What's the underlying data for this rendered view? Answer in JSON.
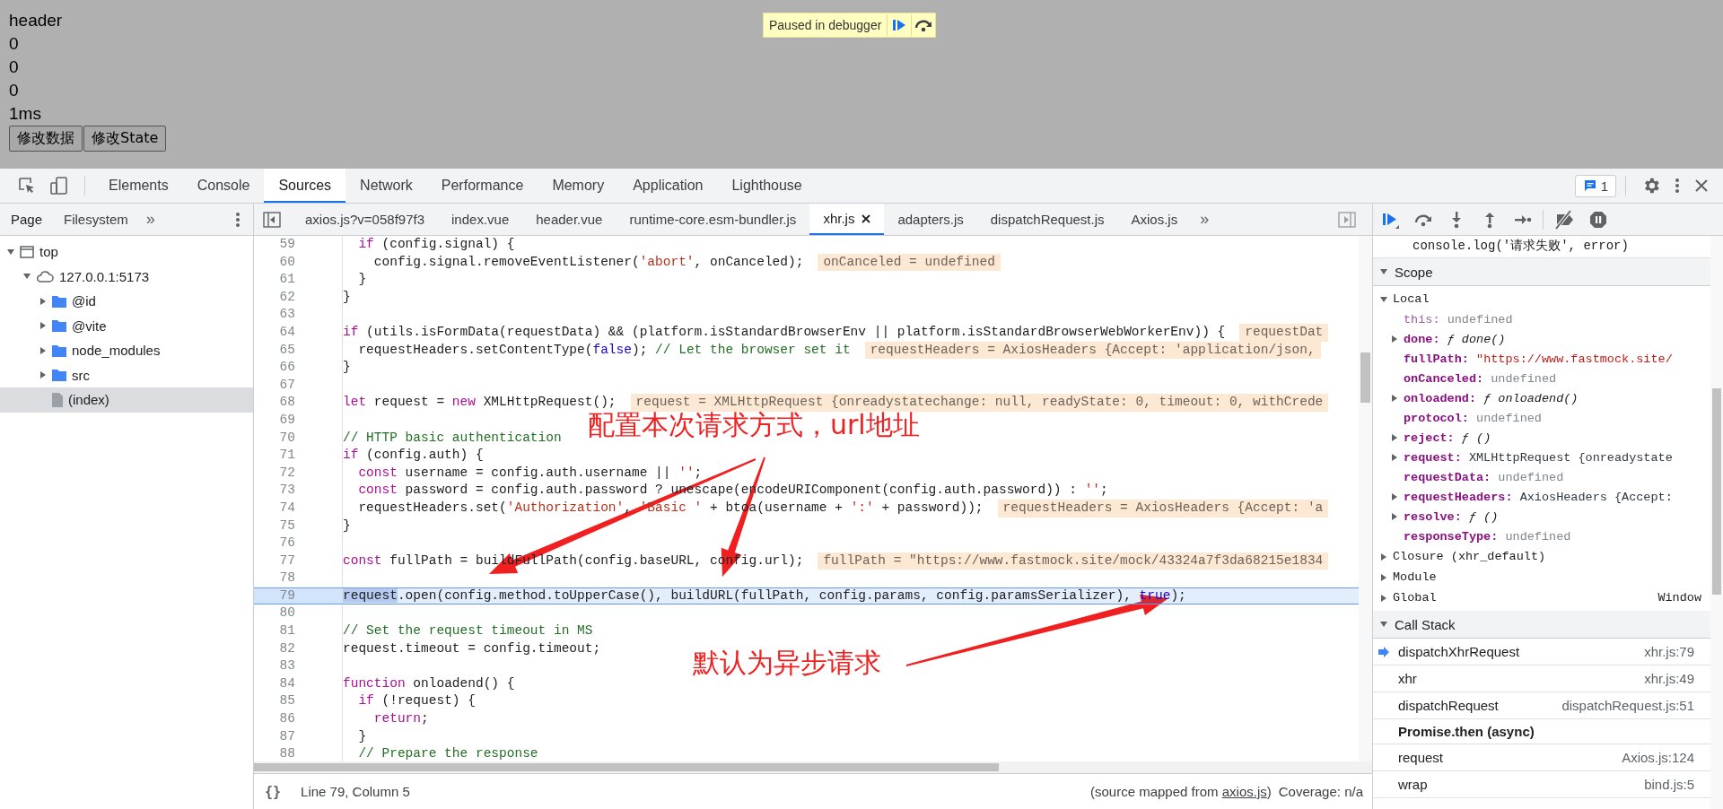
{
  "page": {
    "lines": [
      "header",
      "0",
      "0",
      "0",
      "1ms"
    ],
    "buttons": [
      "修改数据",
      "修改State"
    ]
  },
  "paused_banner": {
    "text": "Paused in debugger"
  },
  "devtools": {
    "tabs": [
      {
        "label": "Elements",
        "selected": false
      },
      {
        "label": "Console",
        "selected": false
      },
      {
        "label": "Sources",
        "selected": true
      },
      {
        "label": "Network",
        "selected": false
      },
      {
        "label": "Performance",
        "selected": false
      },
      {
        "label": "Memory",
        "selected": false
      },
      {
        "label": "Application",
        "selected": false
      },
      {
        "label": "Lighthouse",
        "selected": false
      }
    ],
    "issues_badge": "1",
    "navigator": {
      "tabs": [
        {
          "label": "Page",
          "selected": true
        },
        {
          "label": "Filesystem",
          "selected": false
        }
      ],
      "more": "»",
      "tree": [
        {
          "label": "top",
          "kind": "frame",
          "expanded": true,
          "selected": false,
          "children": [
            {
              "label": "127.0.0.1:5173",
              "kind": "origin",
              "expanded": true,
              "selected": false,
              "children": [
                {
                  "label": "@id",
                  "kind": "folder",
                  "expanded": false,
                  "selected": false
                },
                {
                  "label": "@vite",
                  "kind": "folder",
                  "expanded": false,
                  "selected": false
                },
                {
                  "label": "node_modules",
                  "kind": "folder",
                  "expanded": false,
                  "selected": false
                },
                {
                  "label": "src",
                  "kind": "folder",
                  "expanded": false,
                  "selected": false
                },
                {
                  "label": "(index)",
                  "kind": "file",
                  "selected": true
                }
              ]
            }
          ]
        }
      ]
    },
    "file_tabs": [
      {
        "label": "axios.js?v=058f97f3",
        "selected": false
      },
      {
        "label": "index.vue",
        "selected": false
      },
      {
        "label": "header.vue",
        "selected": false
      },
      {
        "label": "runtime-core.esm-bundler.js",
        "selected": false
      },
      {
        "label": "xhr.js",
        "selected": true
      },
      {
        "label": "adapters.js",
        "selected": false
      },
      {
        "label": "dispatchRequest.js",
        "selected": false
      },
      {
        "label": "Axios.js",
        "selected": false
      }
    ],
    "file_tabs_more": "»",
    "code_lines": [
      {
        "number": "59",
        "selected": false,
        "segments": [
          {
            "kind": "keyword",
            "text": "  if"
          },
          {
            "kind": "plain",
            "text": " (config.signal) {"
          }
        ]
      },
      {
        "number": "60",
        "selected": false,
        "segments": [
          {
            "kind": "plain",
            "text": "    config.signal.removeEventListener("
          },
          {
            "kind": "string",
            "text": "'abort'"
          },
          {
            "kind": "plain",
            "text": ", onCanceled);"
          }
        ],
        "inline_value": "onCanceled = undefined"
      },
      {
        "number": "61",
        "selected": false,
        "segments": [
          {
            "kind": "plain",
            "text": "  }"
          }
        ]
      },
      {
        "number": "62",
        "selected": false,
        "segments": [
          {
            "kind": "plain",
            "text": "}"
          }
        ]
      },
      {
        "number": "63",
        "selected": false
      },
      {
        "number": "64",
        "selected": false,
        "segments": [
          {
            "kind": "keyword",
            "text": "if"
          },
          {
            "kind": "plain",
            "text": " (utils.isFormData(requestData) && (platform.isStandardBrowserEnv || platform.isStandardBrowserWebWorkerEnv)) {"
          }
        ],
        "inline_value": "requestDat"
      },
      {
        "number": "65",
        "selected": false,
        "segments": [
          {
            "kind": "plain",
            "text": "  requestHeaders.setContentType("
          },
          {
            "kind": "literal",
            "text": "false"
          },
          {
            "kind": "plain",
            "text": "); "
          },
          {
            "kind": "comment",
            "text": "// Let the browser set it"
          }
        ],
        "inline_value": "requestHeaders = AxiosHeaders {Accept: 'application/json,"
      },
      {
        "number": "66",
        "selected": false,
        "segments": [
          {
            "kind": "plain",
            "text": "}"
          }
        ]
      },
      {
        "number": "67",
        "selected": false
      },
      {
        "number": "68",
        "selected": false,
        "segments": [
          {
            "kind": "keyword",
            "text": "let"
          },
          {
            "kind": "plain",
            "text": " request = "
          },
          {
            "kind": "keyword",
            "text": "new"
          },
          {
            "kind": "plain",
            "text": " XMLHttpRequest();"
          }
        ],
        "inline_value": "request = XMLHttpRequest {onreadystatechange: null, readyState: 0, timeout: 0, withCrede"
      },
      {
        "number": "69",
        "selected": false
      },
      {
        "number": "70",
        "selected": false,
        "segments": [
          {
            "kind": "comment",
            "text": "// HTTP basic authentication"
          }
        ]
      },
      {
        "number": "71",
        "selected": false,
        "segments": [
          {
            "kind": "keyword",
            "text": "if"
          },
          {
            "kind": "plain",
            "text": " (config.auth) {"
          }
        ]
      },
      {
        "number": "72",
        "selected": false,
        "segments": [
          {
            "kind": "keyword",
            "text": "  const"
          },
          {
            "kind": "plain",
            "text": " username = config.auth.username || "
          },
          {
            "kind": "string",
            "text": "''"
          },
          {
            "kind": "plain",
            "text": ";"
          }
        ]
      },
      {
        "number": "73",
        "selected": false,
        "segments": [
          {
            "kind": "keyword",
            "text": "  const"
          },
          {
            "kind": "plain",
            "text": " password = config.auth.password ? unescape(encodeURIComponent(config.auth.password)) : "
          },
          {
            "kind": "string",
            "text": "''"
          },
          {
            "kind": "plain",
            "text": ";"
          }
        ]
      },
      {
        "number": "74",
        "selected": false,
        "segments": [
          {
            "kind": "plain",
            "text": "  requestHeaders.set("
          },
          {
            "kind": "string",
            "text": "'Authorization'"
          },
          {
            "kind": "plain",
            "text": ", "
          },
          {
            "kind": "string",
            "text": "'Basic '"
          },
          {
            "kind": "plain",
            "text": " + btoa(username + "
          },
          {
            "kind": "string",
            "text": "':'"
          },
          {
            "kind": "plain",
            "text": " + password));"
          }
        ],
        "inline_value": "requestHeaders = AxiosHeaders {Accept: 'a"
      },
      {
        "number": "75",
        "selected": false,
        "segments": [
          {
            "kind": "plain",
            "text": "}"
          }
        ]
      },
      {
        "number": "76",
        "selected": false
      },
      {
        "number": "77",
        "selected": false,
        "segments": [
          {
            "kind": "keyword",
            "text": "const"
          },
          {
            "kind": "plain",
            "text": " fullPath = buildFullPath(config.baseURL, config.url);"
          }
        ],
        "inline_value": "fullPath = \"https://www.fastmock.site/mock/43324a7f3da68215e1834"
      },
      {
        "number": "78",
        "selected": false
      },
      {
        "number": "79",
        "selected": true,
        "segments": [
          {
            "kind": "match",
            "text": "request"
          },
          {
            "kind": "plain",
            "text": ".open(config.method.toUpperCase(), buildURL(fullPath, config.params, config.paramsSerializer), "
          },
          {
            "kind": "literal",
            "text": "true"
          },
          {
            "kind": "plain",
            "text": ");"
          }
        ]
      },
      {
        "number": "80",
        "selected": false
      },
      {
        "number": "81",
        "selected": false,
        "segments": [
          {
            "kind": "comment",
            "text": "// Set the request timeout in MS"
          }
        ]
      },
      {
        "number": "82",
        "selected": false,
        "segments": [
          {
            "kind": "plain",
            "text": "request.timeout = config.timeout;"
          }
        ]
      },
      {
        "number": "83",
        "selected": false
      },
      {
        "number": "84",
        "selected": false,
        "segments": [
          {
            "kind": "keyword",
            "text": "function"
          },
          {
            "kind": "plain",
            "text": " onloadend() {"
          }
        ]
      },
      {
        "number": "85",
        "selected": false,
        "segments": [
          {
            "kind": "keyword",
            "text": "  if"
          },
          {
            "kind": "plain",
            "text": " (!request) {"
          }
        ]
      },
      {
        "number": "86",
        "selected": false,
        "segments": [
          {
            "kind": "keyword",
            "text": "    return"
          },
          {
            "kind": "plain",
            "text": ";"
          }
        ]
      },
      {
        "number": "87",
        "selected": false,
        "segments": [
          {
            "kind": "plain",
            "text": "  }"
          }
        ]
      },
      {
        "number": "88",
        "selected": false,
        "segments": [
          {
            "kind": "comment",
            "text": "  // Prepare the response"
          }
        ]
      }
    ],
    "status_bar": {
      "format_icon": "{}",
      "position": "Line 79, Column 5",
      "source_map": {
        "before": "(source mapped from ",
        "link": "axios.js",
        "after": ")"
      },
      "coverage": "Coverage: n/a"
    },
    "debugger": {
      "breakpoint_preview": "console.log('请求失败', error)",
      "scope": {
        "label": "Scope",
        "expanded": true,
        "sections": [
          {
            "label": "Local",
            "expanded": true,
            "variables": [
              {
                "name": "this:",
                "value": "undefined",
                "kind": "undefined",
                "expandable": false
              },
              {
                "name": "done:",
                "value": "ƒ done()",
                "kind": "function",
                "expandable": true
              },
              {
                "name": "fullPath:",
                "value": "\"https://www.fastmock.site/",
                "kind": "string",
                "expandable": false
              },
              {
                "name": "onCanceled:",
                "value": "undefined",
                "kind": "undefined",
                "expandable": false
              },
              {
                "name": "onloadend:",
                "value": "ƒ onloadend()",
                "kind": "function",
                "expandable": true
              },
              {
                "name": "protocol:",
                "value": "undefined",
                "kind": "undefined",
                "expandable": false
              },
              {
                "name": "reject:",
                "value": "ƒ ()",
                "kind": "function",
                "expandable": true
              },
              {
                "name": "request:",
                "value": "XMLHttpRequest {onreadystate",
                "kind": "object",
                "expandable": true
              },
              {
                "name": "requestData:",
                "value": "undefined",
                "kind": "undefined",
                "expandable": false
              },
              {
                "name": "requestHeaders:",
                "value": "AxiosHeaders {Accept:",
                "kind": "object",
                "expandable": true
              },
              {
                "name": "resolve:",
                "value": "ƒ ()",
                "kind": "function",
                "expandable": true
              },
              {
                "name": "responseType:",
                "value": "undefined",
                "kind": "undefined",
                "expandable": false
              }
            ]
          },
          {
            "label": "Closure (xhr_default)",
            "expanded": false
          },
          {
            "label": "Module",
            "expanded": false
          },
          {
            "label": "Global",
            "expanded": false,
            "value": "Window"
          }
        ]
      },
      "call_stack": {
        "label": "Call Stack",
        "expanded": true,
        "frames": [
          {
            "kind": "frame",
            "name": "dispatchXhrRequest",
            "location": "xhr.js:79",
            "selected": true
          },
          {
            "kind": "frame",
            "name": "xhr",
            "location": "xhr.js:49",
            "selected": false
          },
          {
            "kind": "frame",
            "name": "dispatchRequest",
            "location": "dispatchRequest.js:51",
            "selected": false
          },
          {
            "kind": "async",
            "name": "Promise.then (async)"
          },
          {
            "kind": "frame",
            "name": "request",
            "location": "Axios.js:124",
            "selected": false
          },
          {
            "kind": "frame",
            "name": "wrap",
            "location": "bind.js:5",
            "selected": false
          }
        ]
      }
    }
  },
  "annotations": [
    {
      "text": "配置本次请求方式，url地址"
    },
    {
      "text": "默认为异步请求"
    }
  ]
}
